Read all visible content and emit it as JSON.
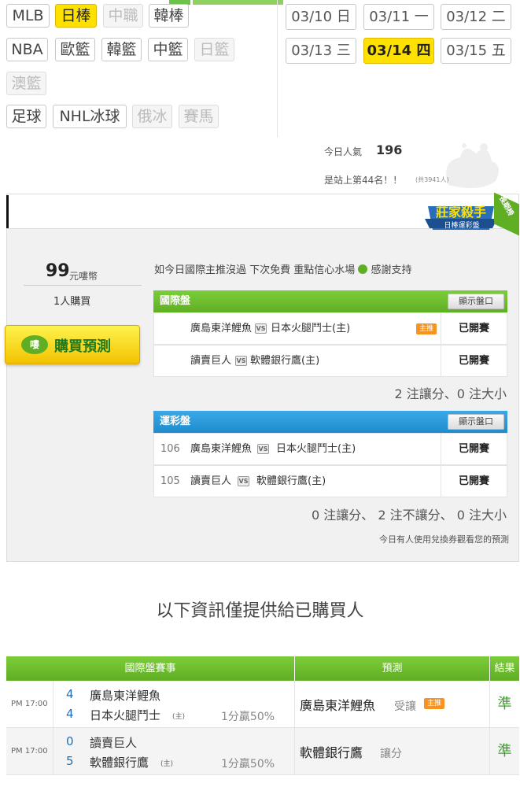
{
  "sports": {
    "row1": [
      {
        "label": "MLB",
        "state": "normal"
      },
      {
        "label": "日棒",
        "state": "active"
      },
      {
        "label": "中職",
        "state": "disabled"
      },
      {
        "label": "韓棒",
        "state": "normal"
      }
    ],
    "row2": [
      {
        "label": "NBA",
        "state": "normal"
      },
      {
        "label": "歐籃",
        "state": "normal"
      },
      {
        "label": "韓籃",
        "state": "normal"
      },
      {
        "label": "中籃",
        "state": "normal"
      },
      {
        "label": "日籃",
        "state": "disabled"
      }
    ],
    "row3": [
      {
        "label": "澳籃",
        "state": "disabled"
      }
    ],
    "row4": [
      {
        "label": "足球",
        "state": "normal"
      },
      {
        "label": "NHL冰球",
        "state": "normal"
      },
      {
        "label": "俄冰",
        "state": "disabled"
      },
      {
        "label": "賽馬",
        "state": "disabled"
      }
    ]
  },
  "dates": [
    {
      "label": "03/10 日",
      "active": false
    },
    {
      "label": "03/11 一",
      "active": false
    },
    {
      "label": "03/12 二",
      "active": false
    },
    {
      "label": "03/13 三",
      "active": false
    },
    {
      "label": "03/14 四",
      "active": true
    },
    {
      "label": "03/15 五",
      "active": false
    }
  ],
  "popularity": {
    "label": "今日人氣",
    "value": "196",
    "rank_text": "是站上第44名！！",
    "total_text": "(共3941人)"
  },
  "seller": {
    "badge_title": "莊家殺手",
    "badge_sub": "日棒運彩盤",
    "ribbon": "長期榜"
  },
  "purchase": {
    "price": "99",
    "price_unit": "元嘍幣",
    "buyers": "1人購買",
    "buy_button": "購買預測",
    "buy_icon": "嘍"
  },
  "notice": "如今日國際主推沒過 下次免費 重點信心水場",
  "notice_tail": "感謝支持",
  "intl": {
    "title": "國際盤",
    "show_button": "顯示盤口",
    "games": [
      {
        "home": "廣島東洋鯉魚",
        "away": "日本火腿鬥士(主)",
        "badge": "主推",
        "status": "已開賽"
      },
      {
        "home": "讀賣巨人",
        "away": "軟體銀行鷹(主)",
        "badge": "",
        "status": "已開賽"
      }
    ],
    "summary": "2 注讓分、0 注大小"
  },
  "lottery": {
    "title": "運彩盤",
    "show_button": "顯示盤口",
    "games": [
      {
        "num": "106",
        "home": "廣島東洋鯉魚",
        "away": "日本火腿鬥士(主)",
        "status": "已開賽"
      },
      {
        "num": "105",
        "home": "讀賣巨人",
        "away": "軟體銀行鷹(主)",
        "status": "已開賽"
      }
    ],
    "summary": "0 注讓分、 2 注不讓分、 0 注大小",
    "footnote": "今日有人使用兌換券觀看您的預測"
  },
  "purchased_heading": "以下資訊僅提供給已購買人",
  "results": {
    "headers": {
      "match": "國際盤賽事",
      "prediction": "預測",
      "result": "結果"
    },
    "rows": [
      {
        "time": "PM 17:00",
        "score1": "4",
        "team1": "廣島東洋鯉魚",
        "score2": "4",
        "team2": "日本火腿鬥士",
        "home_mark": "(主)",
        "line": "1分贏50%",
        "pick": "廣島東洋鯉魚",
        "pick_type": "受讓",
        "pick_badge": "主推",
        "result": "準"
      },
      {
        "time": "PM 17:00",
        "score1": "0",
        "team1": "讀賣巨人",
        "score2": "5",
        "team2": "軟體銀行鷹",
        "home_mark": "(主)",
        "line": "1分贏50%",
        "pick": "軟體銀行鷹",
        "pick_type": "讓分",
        "pick_badge": "",
        "result": "準"
      }
    ]
  },
  "colors": {
    "accent_yellow": "#ffe100",
    "green": "#5fae24",
    "blue": "#1f8ccc",
    "result_green": "#3ca12b",
    "score_blue": "#1e6fb8"
  }
}
